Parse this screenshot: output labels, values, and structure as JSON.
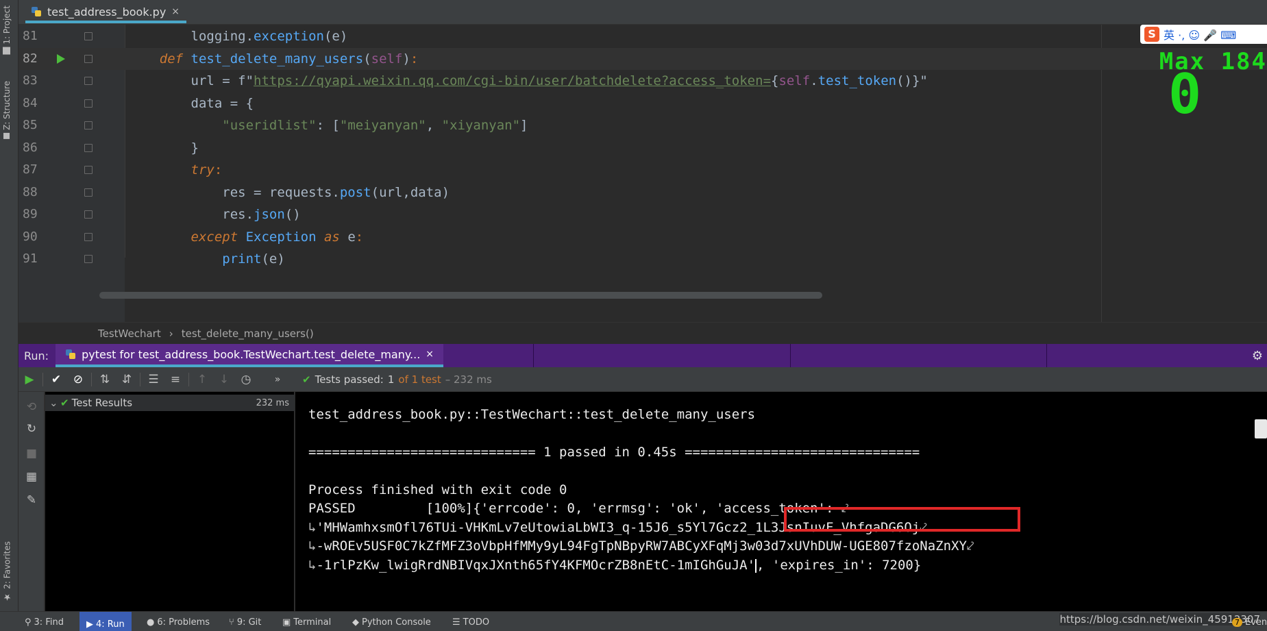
{
  "left_stripe": {
    "project_tab": "1: Project",
    "structure_tab": "Z: Structure",
    "favorites_tab": "2: Favorites"
  },
  "editor_tab": {
    "filename": "test_address_book.py",
    "close": "×"
  },
  "code_lines": [
    {
      "num": "81",
      "text_parts": [
        [
          "",
          "        logging."
        ],
        [
          "call",
          "exception"
        ],
        [
          "",
          "(e)"
        ]
      ]
    },
    {
      "num": "82",
      "text_parts": [
        [
          "kwi",
          "    def "
        ],
        [
          "fn",
          "test_delete_many_users"
        ],
        [
          "",
          "("
        ],
        [
          "self",
          "self"
        ],
        [
          "",
          ")"
        ],
        [
          "kw",
          ":"
        ]
      ]
    },
    {
      "num": "83",
      "text_parts": [
        [
          "",
          "        url = f\""
        ],
        [
          "url",
          "https://qyapi.weixin.qq.com/cgi-bin/user/batchdelete?access_token="
        ],
        [
          "",
          "{"
        ],
        [
          "self",
          "self"
        ],
        [
          "",
          "."
        ],
        [
          "call",
          "test_token"
        ],
        [
          "",
          "()}\""
        ]
      ]
    },
    {
      "num": "84",
      "text_parts": [
        [
          "",
          "        data = {"
        ]
      ]
    },
    {
      "num": "85",
      "text_parts": [
        [
          "",
          "            "
        ],
        [
          "str",
          "\"useridlist\""
        ],
        [
          "",
          ": ["
        ],
        [
          "str",
          "\"meiyanyan\""
        ],
        [
          "",
          ", "
        ],
        [
          "str",
          "\"xiyanyan\""
        ],
        [
          "",
          "]"
        ]
      ]
    },
    {
      "num": "86",
      "text_parts": [
        [
          "",
          "        }"
        ]
      ]
    },
    {
      "num": "87",
      "text_parts": [
        [
          "kwi",
          "        try"
        ],
        [
          "kw",
          ":"
        ]
      ]
    },
    {
      "num": "88",
      "text_parts": [
        [
          "",
          "            res = requests."
        ],
        [
          "call",
          "post"
        ],
        [
          "",
          "(url,data)"
        ]
      ]
    },
    {
      "num": "89",
      "text_parts": [
        [
          "",
          "            res."
        ],
        [
          "call",
          "json"
        ],
        [
          "",
          "()"
        ]
      ]
    },
    {
      "num": "90",
      "text_parts": [
        [
          "kwi",
          "        except "
        ],
        [
          "exc",
          "Exception"
        ],
        [
          "kwi",
          " as "
        ],
        [
          "",
          "e"
        ],
        [
          "kw",
          ":"
        ]
      ]
    },
    {
      "num": "91",
      "text_parts": [
        [
          "",
          "            "
        ],
        [
          "call",
          "print"
        ],
        [
          "",
          "(e)"
        ]
      ]
    }
  ],
  "overlay": {
    "ime_chars": "英 ·, ☺ 🎤 ⌨",
    "ime_logo": "S",
    "max_text": "Max 184",
    "big_number": "0"
  },
  "breadcrumb": {
    "class": "TestWechart",
    "separator": "›",
    "method": "test_delete_many_users()"
  },
  "run_header": {
    "label": "Run:",
    "tab_title": "pytest for test_address_book.TestWechart.test_delete_many...",
    "close": "×"
  },
  "run_toolbar": {
    "tests_passed_label": "Tests passed:",
    "passed_count": "1",
    "of_total": "of 1 test",
    "duration": "– 232 ms"
  },
  "test_tree": {
    "root_label": "Test Results",
    "root_time": "232 ms"
  },
  "console": {
    "lines": [
      "test_address_book.py::TestWechart::test_delete_many_users",
      "",
      "============================= 1 passed in 0.45s ==============================",
      "",
      "Process finished with exit code 0"
    ],
    "passed_prefix": "PASSED         [100%]{",
    "passed_highlight": "'errcode': 0, 'errmsg': 'ok',",
    "passed_suffix": " 'access_token': ",
    "token_line_1": "'MHWamhxsmOfl76TUi-VHKmLv7eUtowiaLbWI3_q-15J6_s5Yl7Gcz2_1L3JsnIuvF_VhfgaDG6Oj",
    "token_line_2": "-wROEv5USF0C7kZfMFZ3oVbpHfMMy9yL94FgTpNBpyRW7ABCyXFqMj3w03d7xUVhDUW-UGE807fzoNaZnXY",
    "token_line_3": "-1rlPzKw_lwigRrdNBIVqxJXnth65fY4KFMOcrZB8nEtC-1mIGhGuJA'",
    "token_tail": ", 'expires_in': 7200}",
    "wrap_out": "⤦",
    "wrap_in": "↳"
  },
  "bottom_bar": {
    "find": "3: Find",
    "run": "4: Run",
    "problems": "6: Problems",
    "git": "9: Git",
    "terminal": "Terminal",
    "python_console": "Python Console",
    "todo": "TODO",
    "event": "Even",
    "event_count": "7"
  },
  "watermark": "https://blog.csdn.net/weixin_45912307",
  "colors": {
    "accent": "#4aa8c9",
    "run_bar": "#4b1f78",
    "passed_green": "#4ebd3d",
    "highlight_red": "#e02828",
    "overlay_green": "#1ddb1d"
  }
}
